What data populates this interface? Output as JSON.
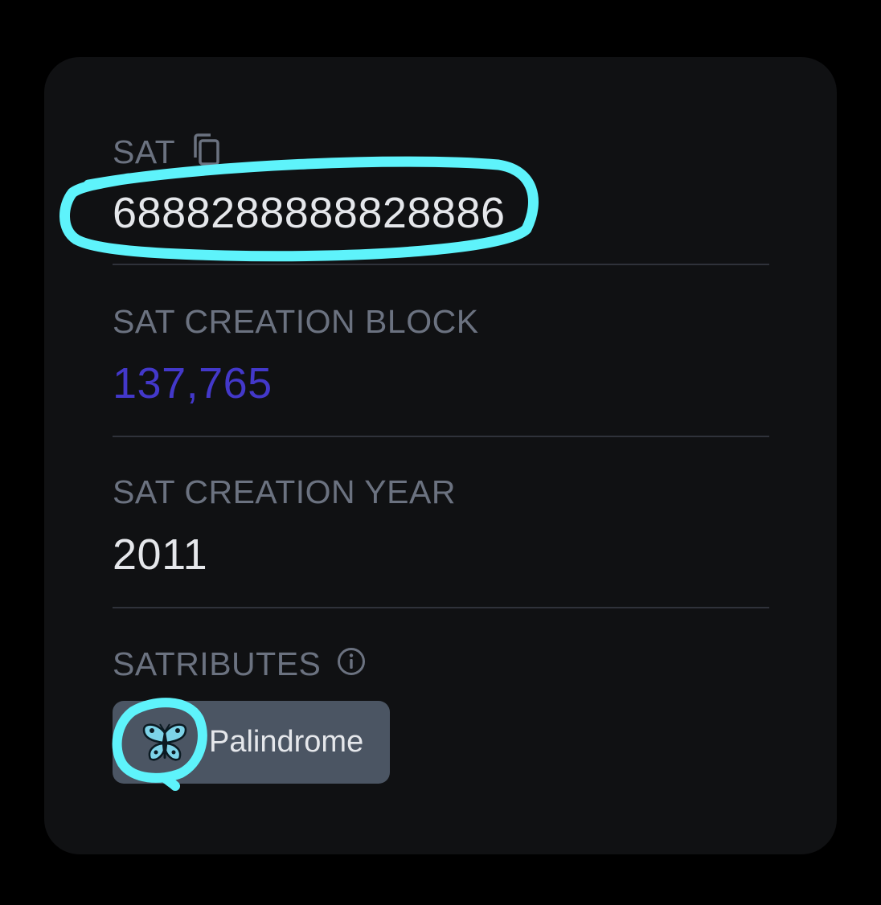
{
  "sat": {
    "label": "SAT",
    "copy_icon": "copy-icon",
    "value": "6888288888828886"
  },
  "creation_block": {
    "label": "SAT CREATION BLOCK",
    "value": "137,765"
  },
  "creation_year": {
    "label": "SAT CREATION YEAR",
    "value": "2011"
  },
  "satributes": {
    "label": "SATRIBUTES",
    "info_icon": "info-icon",
    "items": [
      {
        "label": "Palindrome",
        "icon": "butterfly-icon"
      }
    ]
  },
  "colors": {
    "card_bg": "#101113",
    "label": "#6b7280",
    "value": "#e5e7eb",
    "link": "#4338ca",
    "badge_bg": "#4b5563",
    "annotation": "#5ef3fb"
  }
}
